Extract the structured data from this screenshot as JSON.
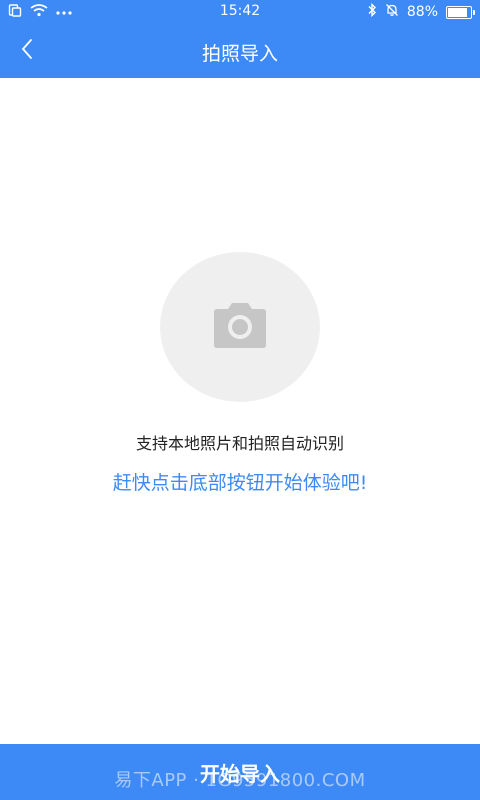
{
  "status_bar": {
    "time": "15:42",
    "battery_text": "88%",
    "battery_level": 0.88
  },
  "header": {
    "title": "拍照导入",
    "back_icon": "chevron-left-icon"
  },
  "main": {
    "placeholder_icon": "camera-icon",
    "line1": "支持本地照片和拍照自动识别",
    "line2": "赶快点击底部按钮开始体验吧!"
  },
  "footer": {
    "start_label": "开始导入",
    "watermark": "易下APP · 1G9591800.COM"
  },
  "colors": {
    "accent": "#3d8af7",
    "placeholder_bg": "#efefef",
    "icon_gray": "#c6c6c6"
  }
}
